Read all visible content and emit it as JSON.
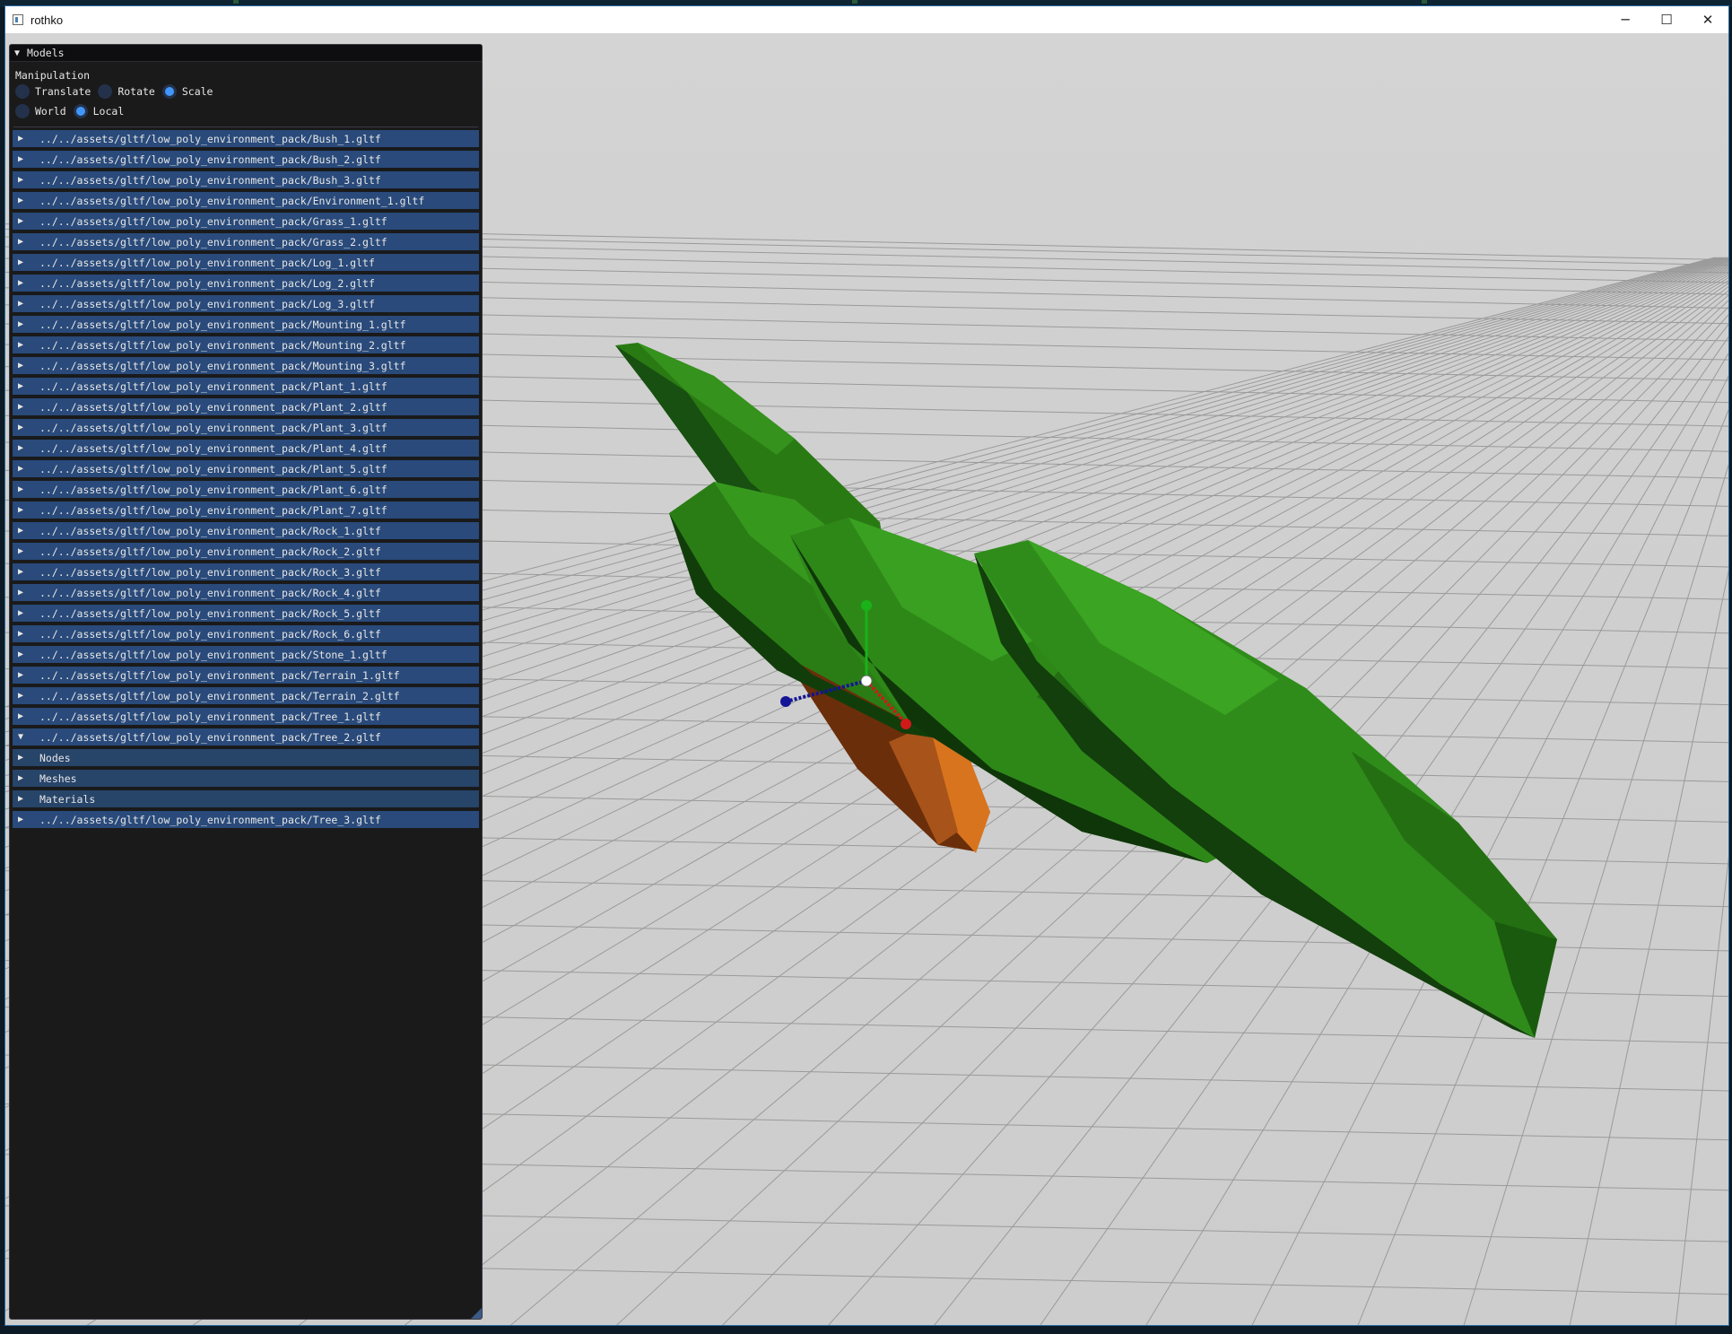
{
  "window": {
    "title": "rothko",
    "controls": {
      "minimize": "─",
      "maximize": "☐",
      "close": "✕"
    }
  },
  "panel": {
    "title": "Models",
    "manipulation_label": "Manipulation",
    "operations": [
      {
        "label": "Translate",
        "selected": false
      },
      {
        "label": "Rotate",
        "selected": false
      },
      {
        "label": "Scale",
        "selected": true
      }
    ],
    "spaces": [
      {
        "label": "World",
        "selected": false
      },
      {
        "label": "Local",
        "selected": true
      }
    ],
    "models": [
      {
        "label": "../../assets/gltf/low_poly_environment_pack/Bush_1.gltf",
        "expanded": false
      },
      {
        "label": "../../assets/gltf/low_poly_environment_pack/Bush_2.gltf",
        "expanded": false
      },
      {
        "label": "../../assets/gltf/low_poly_environment_pack/Bush_3.gltf",
        "expanded": false
      },
      {
        "label": "../../assets/gltf/low_poly_environment_pack/Environment_1.gltf",
        "expanded": false
      },
      {
        "label": "../../assets/gltf/low_poly_environment_pack/Grass_1.gltf",
        "expanded": false
      },
      {
        "label": "../../assets/gltf/low_poly_environment_pack/Grass_2.gltf",
        "expanded": false
      },
      {
        "label": "../../assets/gltf/low_poly_environment_pack/Log_1.gltf",
        "expanded": false
      },
      {
        "label": "../../assets/gltf/low_poly_environment_pack/Log_2.gltf",
        "expanded": false
      },
      {
        "label": "../../assets/gltf/low_poly_environment_pack/Log_3.gltf",
        "expanded": false
      },
      {
        "label": "../../assets/gltf/low_poly_environment_pack/Mounting_1.gltf",
        "expanded": false
      },
      {
        "label": "../../assets/gltf/low_poly_environment_pack/Mounting_2.gltf",
        "expanded": false
      },
      {
        "label": "../../assets/gltf/low_poly_environment_pack/Mounting_3.gltf",
        "expanded": false
      },
      {
        "label": "../../assets/gltf/low_poly_environment_pack/Plant_1.gltf",
        "expanded": false
      },
      {
        "label": "../../assets/gltf/low_poly_environment_pack/Plant_2.gltf",
        "expanded": false
      },
      {
        "label": "../../assets/gltf/low_poly_environment_pack/Plant_3.gltf",
        "expanded": false
      },
      {
        "label": "../../assets/gltf/low_poly_environment_pack/Plant_4.gltf",
        "expanded": false
      },
      {
        "label": "../../assets/gltf/low_poly_environment_pack/Plant_5.gltf",
        "expanded": false
      },
      {
        "label": "../../assets/gltf/low_poly_environment_pack/Plant_6.gltf",
        "expanded": false
      },
      {
        "label": "../../assets/gltf/low_poly_environment_pack/Plant_7.gltf",
        "expanded": false
      },
      {
        "label": "../../assets/gltf/low_poly_environment_pack/Rock_1.gltf",
        "expanded": false
      },
      {
        "label": "../../assets/gltf/low_poly_environment_pack/Rock_2.gltf",
        "expanded": false
      },
      {
        "label": "../../assets/gltf/low_poly_environment_pack/Rock_3.gltf",
        "expanded": false
      },
      {
        "label": "../../assets/gltf/low_poly_environment_pack/Rock_4.gltf",
        "expanded": false
      },
      {
        "label": "../../assets/gltf/low_poly_environment_pack/Rock_5.gltf",
        "expanded": false
      },
      {
        "label": "../../assets/gltf/low_poly_environment_pack/Rock_6.gltf",
        "expanded": false
      },
      {
        "label": "../../assets/gltf/low_poly_environment_pack/Stone_1.gltf",
        "expanded": false
      },
      {
        "label": "../../assets/gltf/low_poly_environment_pack/Terrain_1.gltf",
        "expanded": false
      },
      {
        "label": "../../assets/gltf/low_poly_environment_pack/Terrain_2.gltf",
        "expanded": false
      },
      {
        "label": "../../assets/gltf/low_poly_environment_pack/Tree_1.gltf",
        "expanded": false
      },
      {
        "label": "../../assets/gltf/low_poly_environment_pack/Tree_2.gltf",
        "expanded": true,
        "children": [
          {
            "label": "Nodes"
          },
          {
            "label": "Meshes"
          },
          {
            "label": "Materials"
          }
        ]
      },
      {
        "label": "../../assets/gltf/low_poly_environment_pack/Tree_3.gltf",
        "expanded": false
      }
    ]
  },
  "colors": {
    "accent": "#4296fa",
    "header_bg": "#294a7a",
    "foliage": "#2f8a1a",
    "trunk": "#d8741e",
    "grid_floor": "#cfcfcf",
    "gizmo_x": "#d11919",
    "gizmo_y": "#19b219",
    "gizmo_z": "#141496"
  },
  "icons": {
    "collapsed": "▶",
    "expanded": "▼"
  }
}
